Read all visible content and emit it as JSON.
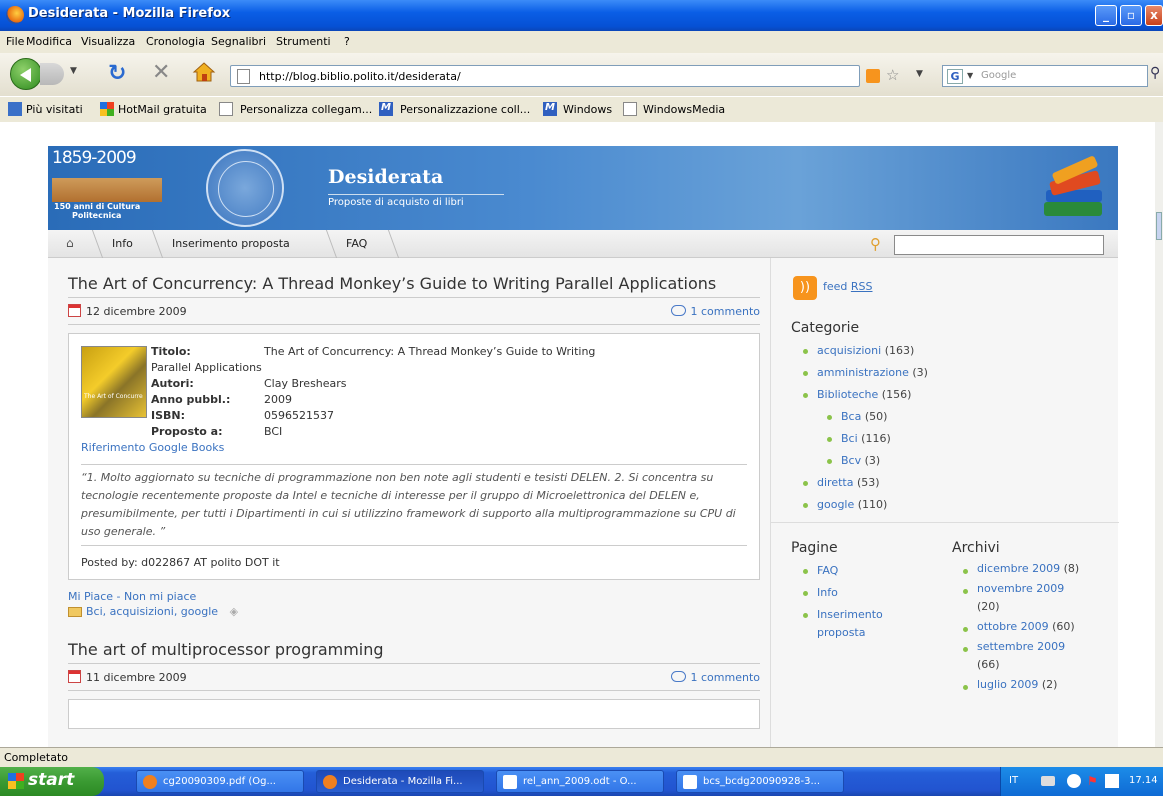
{
  "window": {
    "title": "Desiderata - Mozilla Firefox"
  },
  "menu": [
    "File",
    "Modifica",
    "Visualizza",
    "Cronologia",
    "Segnalibri",
    "Strumenti",
    "?"
  ],
  "url": "http://blog.biblio.polito.it/desiderata/",
  "search_engine_placeholder": "Google",
  "bookmarks": [
    "Più visitati",
    "HotMail gratuita",
    "Personalizza collegam...",
    "Personalizzazione coll...",
    "Windows",
    "WindowsMedia"
  ],
  "site": {
    "logo_years": "1859-2009",
    "logo_caption_1": "150 anni di Cultura",
    "logo_caption_2": "Politecnica",
    "title": "Desiderata",
    "subtitle": "Proposte di acquisto di libri",
    "nav": [
      "Info",
      "Inserimento proposta",
      "FAQ"
    ]
  },
  "post1": {
    "title": "The Art of Concurrency: A Thread Monkey’s Guide to Writing Parallel Applications",
    "date": "12 dicembre 2009",
    "comments": "1 commento",
    "cover_text": "The Art of Concurre",
    "fields": {
      "titolo_label": "Titolo:",
      "titolo_value": "The Art of Concurrency: A Thread Monkey’s Guide to Writing",
      "titolo_cont": "Parallel Applications",
      "autori_label": "Autori:",
      "autori_value": "Clay Breshears",
      "anno_label": "Anno pubbl.:",
      "anno_value": "2009",
      "isbn_label": "ISBN:",
      "isbn_value": "0596521537",
      "proposto_label": "Proposto a:",
      "proposto_value": "BCI"
    },
    "google_books": "Riferimento Google Books",
    "quote": "“1. Molto aggiornato su tecniche di programmazione non ben note agli studenti e tesisti DELEN. 2. Si concentra su tecnologie recentemente proposte da Intel e tecniche di interesse per il gruppo di Microelettronica del DELEN e, presumibilmente, per tutti i Dipartimenti in cui si utilizzino framework di supporto alla multiprogrammazione su CPU di uso generale. ”",
    "posted_by": "Posted by: d022867 AT polito DOT it",
    "like": "Mi Piace - Non mi piace",
    "tags": "Bci, acquisizioni, google"
  },
  "post2": {
    "title": "The art of multiprocessor programming",
    "date": "11 dicembre 2009",
    "comments": "1 commento"
  },
  "sidebar": {
    "feed_text": "feed",
    "feed_link": "RSS",
    "categorie_title": "Categorie",
    "categories": [
      {
        "name": "acquisizioni",
        "count": "(163)"
      },
      {
        "name": "amministrazione",
        "count": "(3)"
      },
      {
        "name": "Biblioteche",
        "count": "(156)"
      },
      {
        "name": "Bca",
        "count": "(50)"
      },
      {
        "name": "Bci",
        "count": "(116)"
      },
      {
        "name": "Bcv",
        "count": "(3)"
      },
      {
        "name": "diretta",
        "count": "(53)"
      },
      {
        "name": "google",
        "count": "(110)"
      }
    ],
    "pagine_title": "Pagine",
    "pagine": [
      "FAQ",
      "Info",
      "Inserimento proposta"
    ],
    "archivi_title": "Archivi",
    "archivi": [
      {
        "name": "dicembre 2009",
        "count": "(8)"
      },
      {
        "name": "novembre 2009",
        "count": "(20)"
      },
      {
        "name": "ottobre 2009",
        "count": "(60)"
      },
      {
        "name": "settembre 2009",
        "count": "(66)"
      },
      {
        "name": "luglio 2009",
        "count": "(2)"
      }
    ]
  },
  "status": "Completato",
  "taskbar": {
    "start": "start",
    "tasks": [
      "cg20090309.pdf (Og...",
      "Desiderata - Mozilla Fi...",
      "rel_ann_2009.odt - O...",
      "bcs_bcdg20090928-3..."
    ],
    "lang": "IT",
    "clock": "17.14"
  }
}
